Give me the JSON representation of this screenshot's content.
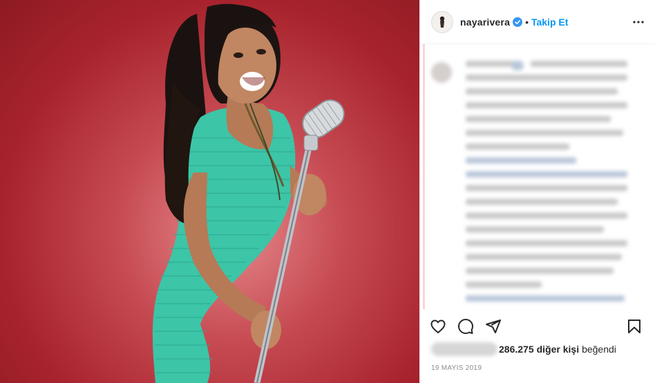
{
  "header": {
    "username": "nayarivera",
    "separator": "•",
    "follow_label": "Takip Et",
    "avatar_icon": "profile-avatar-icon",
    "verified_icon": "verified-badge-icon",
    "more_icon": "more-options-icon"
  },
  "actions": {
    "like_icon": "heart-icon",
    "comment_icon": "comment-icon",
    "share_icon": "paper-plane-icon",
    "save_icon": "bookmark-icon"
  },
  "likes": {
    "count": "286.275",
    "others_label": "diğer kişi",
    "liked_label": "beğendi"
  },
  "date": "19 MAYIS 2019",
  "colors": {
    "accent": "#0095f6",
    "text": "#262626",
    "muted": "#8e8e8e",
    "photo_background": "#a8232d",
    "dress": "#3cc5a7"
  }
}
